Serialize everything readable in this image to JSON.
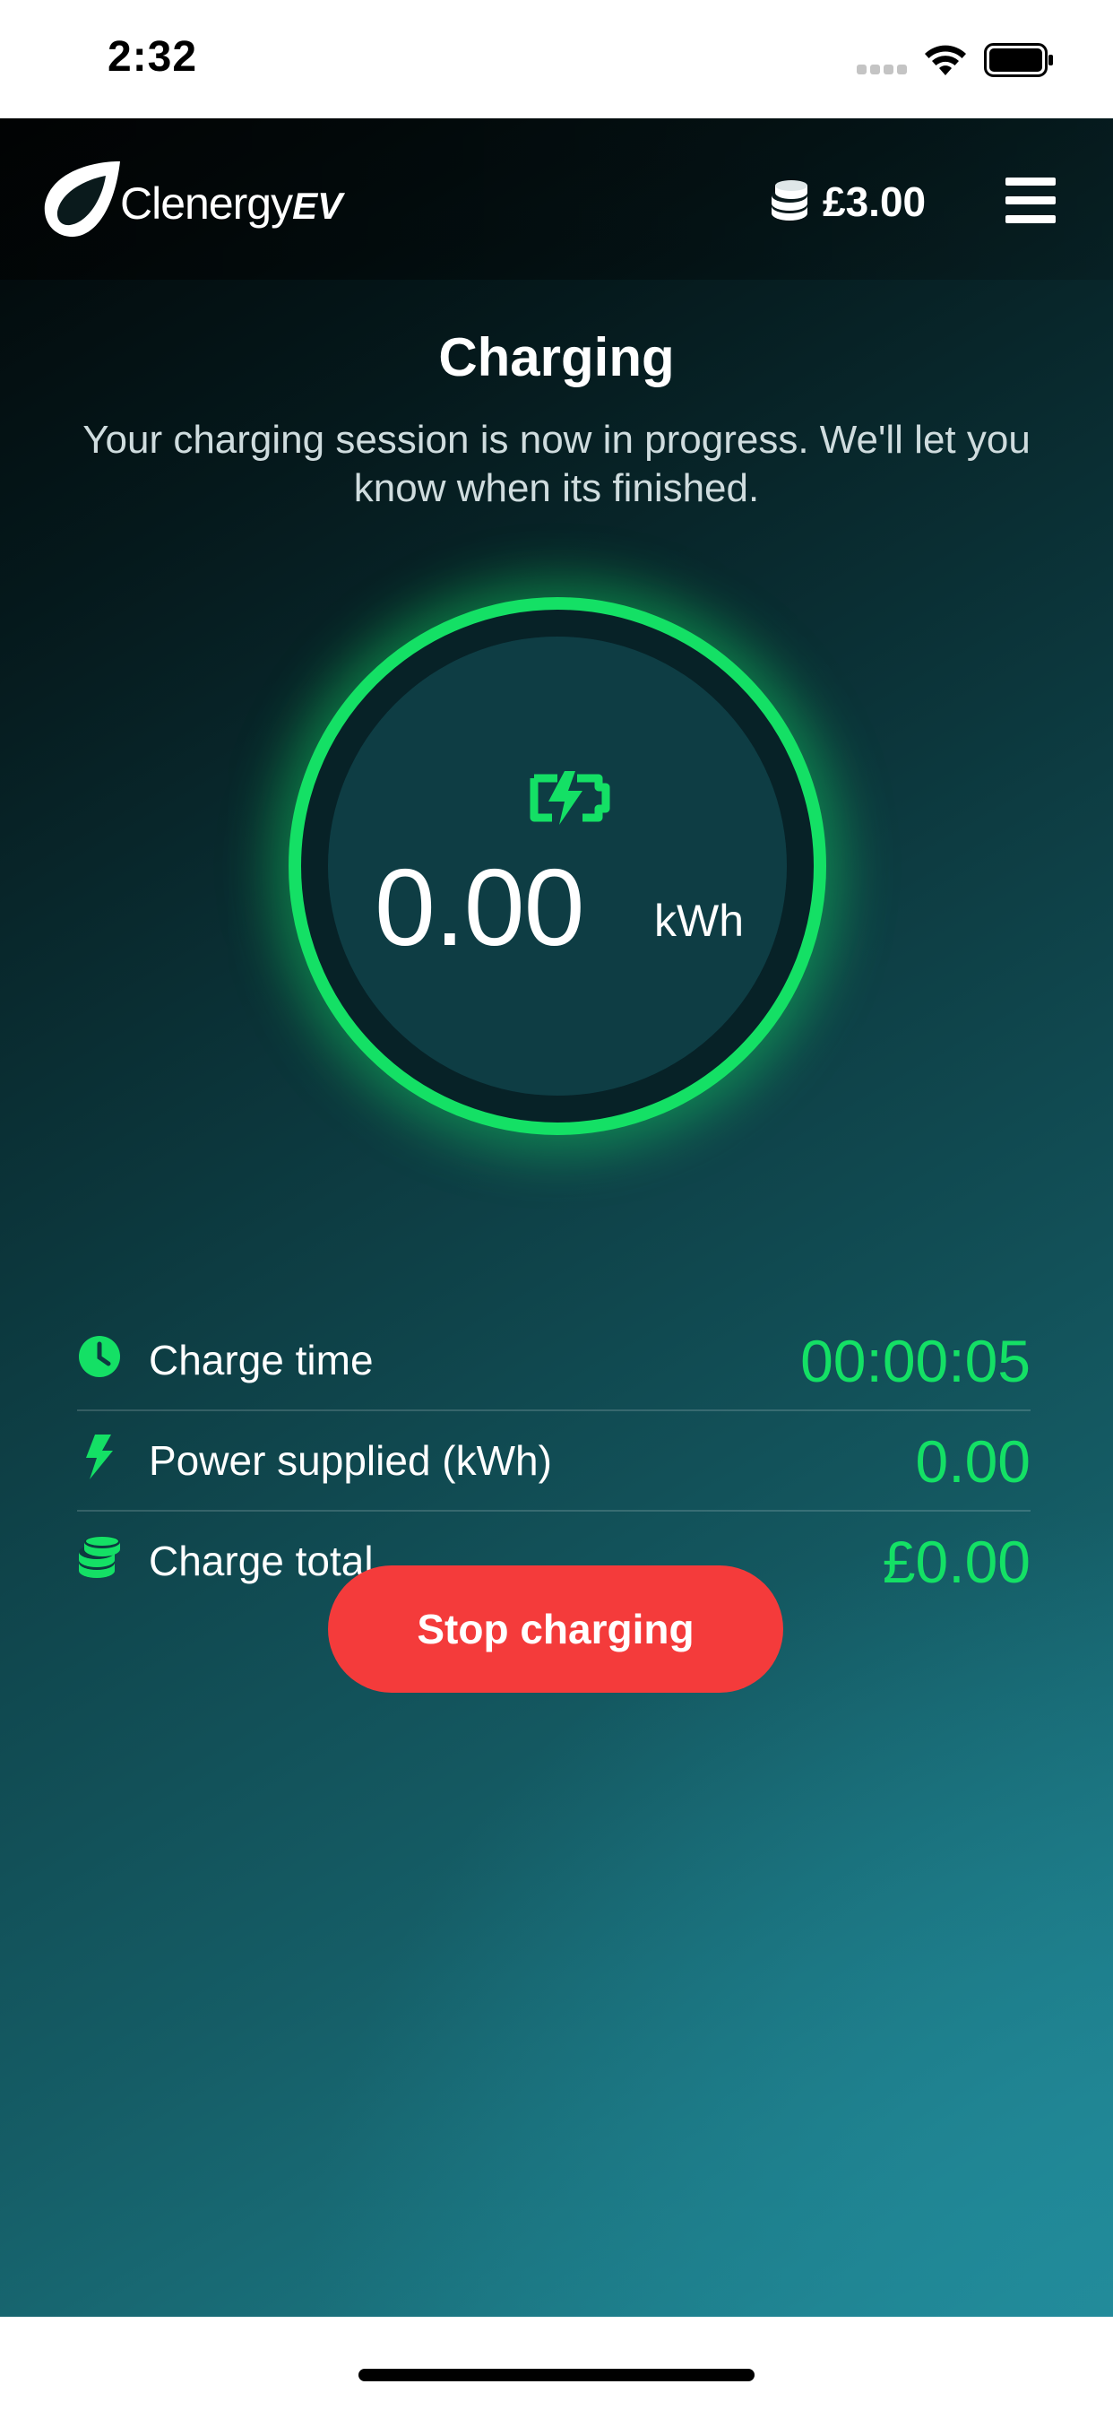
{
  "status_bar": {
    "time": "2:32"
  },
  "header": {
    "brand_name": "Clenergy",
    "brand_suffix": "EV",
    "balance": "£3.00",
    "menu_icon": "hamburger-menu-icon",
    "balance_icon": "coins-icon"
  },
  "session": {
    "title": "Charging",
    "description": "Your charging session is now in progress. We'll let you know when its finished."
  },
  "gauge": {
    "icon": "battery-charging-icon",
    "value": "0.00",
    "unit": "kWh",
    "accent_color": "#14e065"
  },
  "stats": [
    {
      "icon": "clock-icon",
      "label": "Charge time",
      "value": "00:00:05"
    },
    {
      "icon": "lightning-bolt-icon",
      "label": "Power supplied (kWh)",
      "value": "0.00"
    },
    {
      "icon": "coins-icon",
      "label": "Charge total",
      "value": "£0.00"
    }
  ],
  "actions": {
    "stop_label": "Stop charging",
    "stop_color": "#f43b3b"
  }
}
